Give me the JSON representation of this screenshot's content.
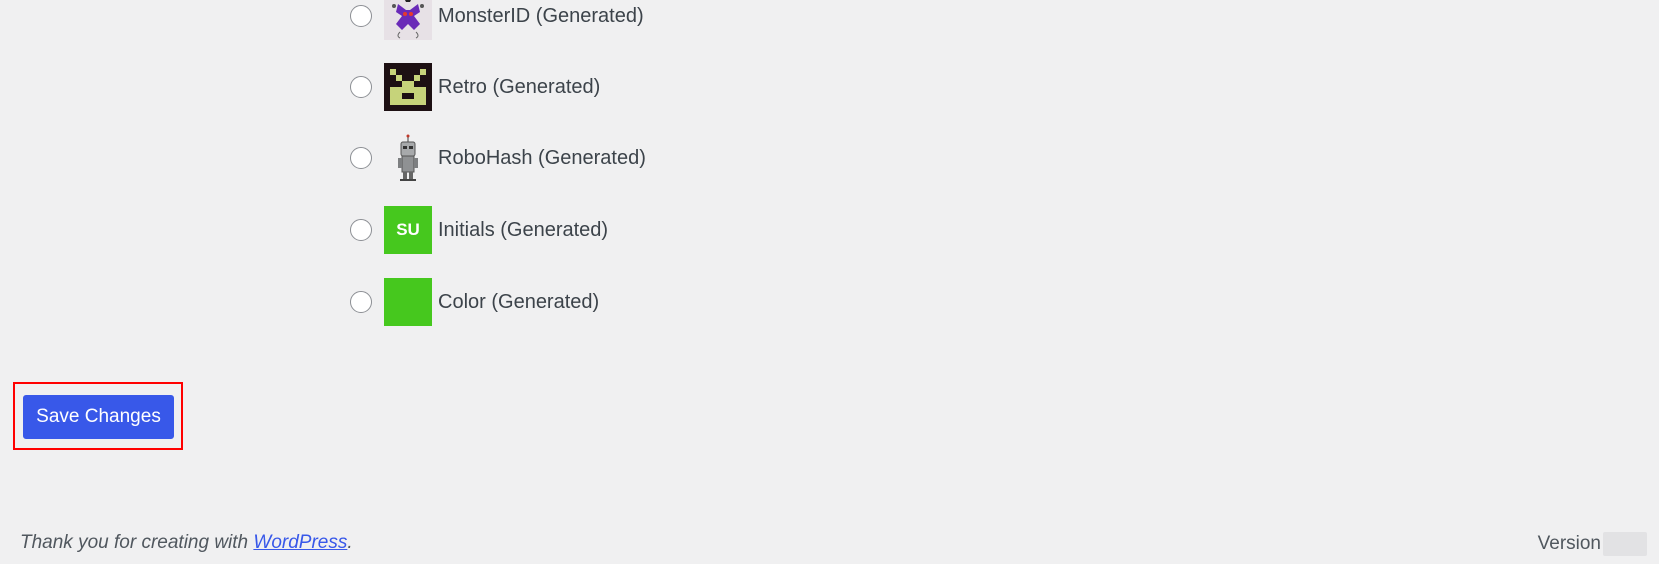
{
  "avatar_options": [
    {
      "label": "MonsterID (Generated)",
      "icon": "monsterid-avatar-icon"
    },
    {
      "label": "Retro (Generated)",
      "icon": "retro-avatar-icon"
    },
    {
      "label": "RoboHash (Generated)",
      "icon": "robohash-avatar-icon"
    },
    {
      "label": "Initials (Generated)",
      "icon": "initials-avatar-icon",
      "initials": "SU"
    },
    {
      "label": "Color (Generated)",
      "icon": "color-avatar-icon"
    }
  ],
  "save_button": {
    "label": "Save Changes"
  },
  "footer": {
    "thanks_prefix": "Thank you for creating with ",
    "thanks_link": "WordPress",
    "thanks_suffix": ".",
    "version_label": "Version"
  },
  "colors": {
    "accent": "#3858e9",
    "background": "#f0f0f1",
    "highlight": "#ff0000",
    "generated_green": "#46c81e"
  }
}
